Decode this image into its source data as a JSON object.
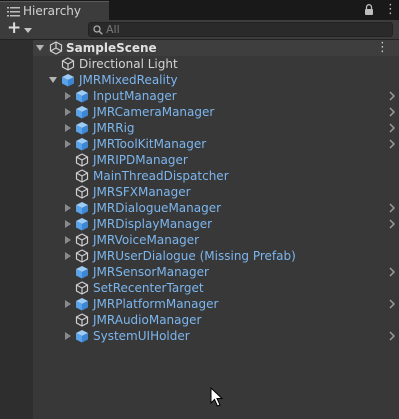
{
  "window": {
    "tab_label": "Hierarchy"
  },
  "toolbar": {
    "search_placeholder": "All"
  },
  "scene": {
    "name": "SampleScene"
  },
  "items": [
    {
      "label": "Directional Light",
      "color": "white",
      "depth": 1,
      "expand": "none",
      "icon": "gameobject-icon",
      "chevron": false
    },
    {
      "label": "JMRMixedReality",
      "color": "blue",
      "depth": 1,
      "expand": "expanded",
      "icon": "prefab-icon",
      "chevron": false
    },
    {
      "label": "InputManager",
      "color": "blue",
      "depth": 2,
      "expand": "collapsed",
      "icon": "prefab-icon",
      "chevron": true
    },
    {
      "label": "JMRCameraManager",
      "color": "blue",
      "depth": 2,
      "expand": "collapsed",
      "icon": "prefab-icon",
      "chevron": true
    },
    {
      "label": "JMRRig",
      "color": "blue",
      "depth": 2,
      "expand": "collapsed",
      "icon": "prefab-icon",
      "chevron": true
    },
    {
      "label": "JMRToolKitManager",
      "color": "blue",
      "depth": 2,
      "expand": "collapsed",
      "icon": "prefab-icon",
      "chevron": true
    },
    {
      "label": "JMRIPDManager",
      "color": "blue",
      "depth": 2,
      "expand": "none",
      "icon": "gameobject-icon",
      "chevron": false
    },
    {
      "label": "MainThreadDispatcher",
      "color": "blue",
      "depth": 2,
      "expand": "none",
      "icon": "gameobject-icon",
      "chevron": false
    },
    {
      "label": "JMRSFXManager",
      "color": "blue",
      "depth": 2,
      "expand": "none",
      "icon": "gameobject-icon",
      "chevron": false
    },
    {
      "label": "JMRDialogueManager",
      "color": "blue",
      "depth": 2,
      "expand": "collapsed",
      "icon": "prefab-icon",
      "chevron": true
    },
    {
      "label": "JMRDisplayManager",
      "color": "blue",
      "depth": 2,
      "expand": "collapsed",
      "icon": "prefab-icon",
      "chevron": true
    },
    {
      "label": "JMRVoiceManager",
      "color": "blue",
      "depth": 2,
      "expand": "collapsed",
      "icon": "gameobject-icon",
      "chevron": false
    },
    {
      "label": "JMRUserDialogue (Missing Prefab)",
      "color": "blue",
      "depth": 2,
      "expand": "collapsed",
      "icon": "gameobject-icon",
      "chevron": false
    },
    {
      "label": "JMRSensorManager",
      "color": "blue",
      "depth": 2,
      "expand": "none",
      "icon": "prefab-icon",
      "chevron": true
    },
    {
      "label": "SetRecenterTarget",
      "color": "blue",
      "depth": 2,
      "expand": "none",
      "icon": "gameobject-icon",
      "chevron": false
    },
    {
      "label": "JMRPlatformManager",
      "color": "blue",
      "depth": 2,
      "expand": "collapsed",
      "icon": "prefab-icon",
      "chevron": true
    },
    {
      "label": "JMRAudioManager",
      "color": "blue",
      "depth": 2,
      "expand": "none",
      "icon": "gameobject-icon",
      "chevron": false
    },
    {
      "label": "SystemUIHolder",
      "color": "blue",
      "depth": 2,
      "expand": "collapsed",
      "icon": "prefab-icon",
      "chevron": true
    }
  ]
}
